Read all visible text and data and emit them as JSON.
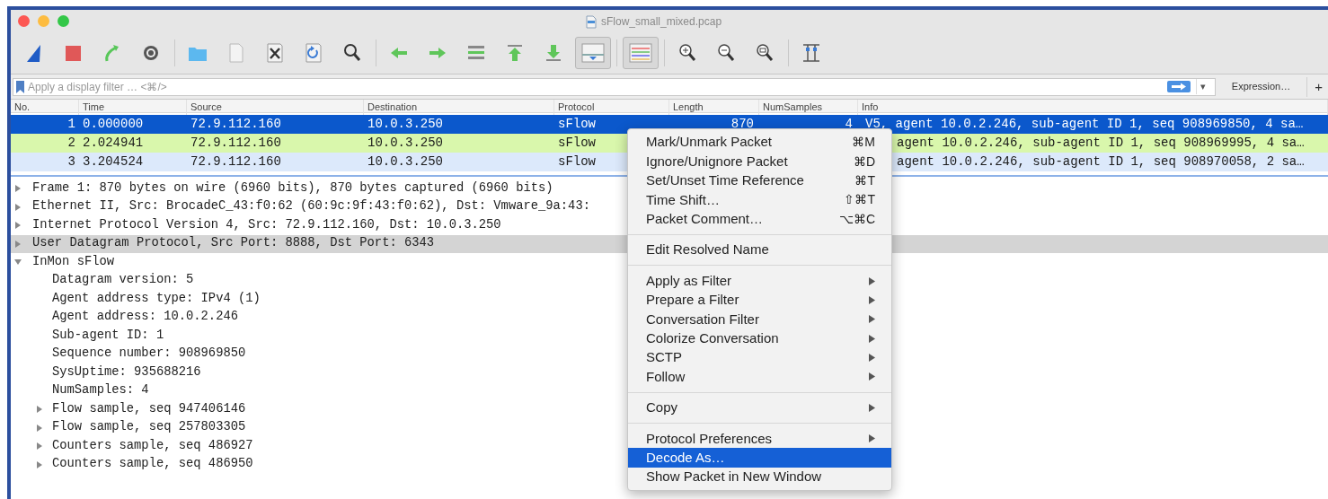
{
  "window": {
    "title": "sFlow_small_mixed.pcap"
  },
  "filter": {
    "placeholder": "Apply a display filter … <⌘/>",
    "dropdown": "▾",
    "expression_button": "Expression…",
    "add_button": "+"
  },
  "packet_list": {
    "columns": [
      "No.",
      "Time",
      "Source",
      "Destination",
      "Protocol",
      "Length",
      "NumSamples",
      "Info"
    ],
    "rows": [
      {
        "no": "1",
        "time": "0.000000",
        "source": "72.9.112.160",
        "destination": "10.0.3.250",
        "protocol": "sFlow",
        "length": "870",
        "num_samples": "4",
        "info": "V5, agent 10.0.2.246, sub-agent ID 1, seq 908969850, 4 sa…",
        "selected": true
      },
      {
        "no": "2",
        "time": "2.024941",
        "source": "72.9.112.160",
        "destination": "10.0.3.250",
        "protocol": "sFlow",
        "info": "agent 10.0.2.246, sub-agent ID 1, seq 908969995, 4 sa…",
        "selected": false,
        "color": "#d9f7ac"
      },
      {
        "no": "3",
        "time": "3.204524",
        "source": "72.9.112.160",
        "destination": "10.0.3.250",
        "protocol": "sFlow",
        "info": "agent 10.0.2.246, sub-agent ID 1, seq 908970058, 2 sa…",
        "selected": false,
        "color": "#dce9fb"
      }
    ]
  },
  "details": [
    {
      "label": "Frame 1: 870 bytes on wire (6960 bits), 870 bytes captured (6960 bits)",
      "kind": "node",
      "expanded": false,
      "selected": false
    },
    {
      "label": "Ethernet II, Src: BrocadeC_43:f0:62 (60:9c:9f:43:f0:62), Dst: Vmware_9a:43:",
      "kind": "node",
      "expanded": false,
      "selected": false
    },
    {
      "label": "Internet Protocol Version 4, Src: 72.9.112.160, Dst: 10.0.3.250",
      "kind": "node",
      "expanded": false,
      "selected": false
    },
    {
      "label": "User Datagram Protocol, Src Port: 8888, Dst Port: 6343",
      "kind": "node",
      "expanded": false,
      "selected": true
    },
    {
      "label": "InMon sFlow",
      "kind": "node",
      "expanded": true,
      "selected": false,
      "children": [
        {
          "label": "Datagram version: 5",
          "kind": "leaf",
          "selected": false
        },
        {
          "label": "Agent address type: IPv4 (1)",
          "kind": "leaf",
          "selected": false
        },
        {
          "label": "Agent address: 10.0.2.246",
          "kind": "leaf",
          "selected": false
        },
        {
          "label": "Sub-agent ID: 1",
          "kind": "leaf",
          "selected": false
        },
        {
          "label": "Sequence number: 908969850",
          "kind": "leaf",
          "selected": false
        },
        {
          "label": "SysUptime: 935688216",
          "kind": "leaf",
          "selected": false
        },
        {
          "label": "NumSamples: 4",
          "kind": "leaf",
          "selected": false
        },
        {
          "label": "Flow sample, seq 947406146",
          "kind": "node",
          "expanded": false,
          "selected": false
        },
        {
          "label": "Flow sample, seq 257803305",
          "kind": "node",
          "expanded": false,
          "selected": false
        },
        {
          "label": "Counters sample, seq 486927",
          "kind": "node",
          "expanded": false,
          "selected": false
        },
        {
          "label": "Counters sample, seq 486950",
          "kind": "node",
          "expanded": false,
          "selected": false
        }
      ]
    }
  ],
  "context_menu": [
    {
      "kind": "item",
      "label": "Mark/Unmark Packet",
      "shortcut": "⌘M",
      "submenu": false,
      "selected": false
    },
    {
      "kind": "item",
      "label": "Ignore/Unignore Packet",
      "shortcut": "⌘D",
      "submenu": false,
      "selected": false
    },
    {
      "kind": "item",
      "label": "Set/Unset Time Reference",
      "shortcut": "⌘T",
      "submenu": false,
      "selected": false
    },
    {
      "kind": "item",
      "label": "Time Shift…",
      "shortcut": "⇧⌘T",
      "submenu": false,
      "selected": false
    },
    {
      "kind": "item",
      "label": "Packet Comment…",
      "shortcut": "⌥⌘C",
      "submenu": false,
      "selected": false
    },
    {
      "kind": "separator"
    },
    {
      "kind": "item",
      "label": "Edit Resolved Name",
      "submenu": false,
      "selected": false
    },
    {
      "kind": "separator"
    },
    {
      "kind": "item",
      "label": "Apply as Filter",
      "submenu": true,
      "selected": false
    },
    {
      "kind": "item",
      "label": "Prepare a Filter",
      "submenu": true,
      "selected": false
    },
    {
      "kind": "item",
      "label": "Conversation Filter",
      "submenu": true,
      "selected": false
    },
    {
      "kind": "item",
      "label": "Colorize Conversation",
      "submenu": true,
      "selected": false
    },
    {
      "kind": "item",
      "label": "SCTP",
      "submenu": true,
      "selected": false
    },
    {
      "kind": "item",
      "label": "Follow",
      "submenu": true,
      "selected": false
    },
    {
      "kind": "separator"
    },
    {
      "kind": "item",
      "label": "Copy",
      "submenu": true,
      "selected": false
    },
    {
      "kind": "separator"
    },
    {
      "kind": "item",
      "label": "Protocol Preferences",
      "submenu": true,
      "selected": false
    },
    {
      "kind": "item",
      "label": "Decode As…",
      "submenu": false,
      "selected": true
    },
    {
      "kind": "item",
      "label": "Show Packet in New Window",
      "submenu": false,
      "selected": false
    }
  ]
}
